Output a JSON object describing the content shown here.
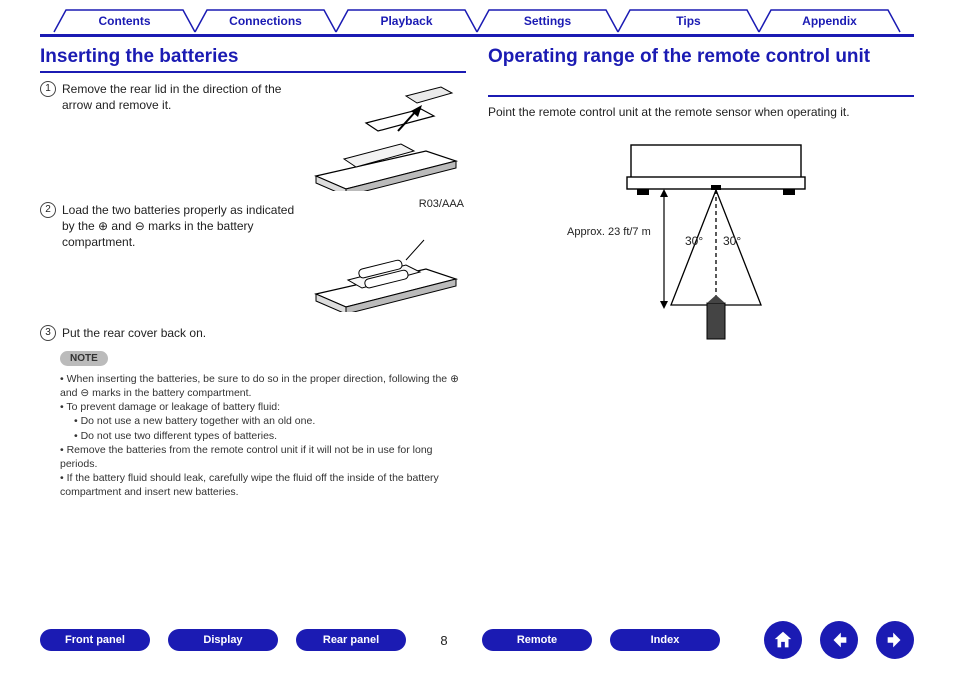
{
  "tabs": [
    "Contents",
    "Connections",
    "Playback",
    "Settings",
    "Tips",
    "Appendix"
  ],
  "left": {
    "heading": "Inserting the batteries",
    "step1_num": "1",
    "step1": "Remove the rear lid in the direction of the arrow and remove it.",
    "step2_num": "2",
    "step2": "Load the two batteries properly as indicated by the ⊕ and ⊖ marks in the battery compartment.",
    "battery_label": "R03/AAA",
    "step3_num": "3",
    "step3": "Put the rear cover back on.",
    "note_label": "NOTE",
    "notes": {
      "n1": "When inserting the batteries, be sure to do so in the proper direction, following the ⊕ and ⊖ marks in the battery compartment.",
      "n2": "To prevent damage or leakage of battery fluid:",
      "n2a": "Do not use a new battery together with an old one.",
      "n2b": "Do not use two different types of batteries.",
      "n3": "Remove the batteries from the remote control unit if it will not be in use for long periods.",
      "n4": "If the battery fluid should leak, carefully wipe the fluid off the inside of the battery compartment and insert new batteries."
    }
  },
  "right": {
    "heading": "Operating range of the remote control unit",
    "desc": "Point the remote control unit at the remote sensor when operating it.",
    "distance": "Approx. 23 ft/7 m",
    "angle_left": "30°",
    "angle_right": "30°"
  },
  "bottom": {
    "front": "Front panel",
    "display": "Display",
    "rear": "Rear panel",
    "page": "8",
    "remote": "Remote",
    "index": "Index"
  }
}
